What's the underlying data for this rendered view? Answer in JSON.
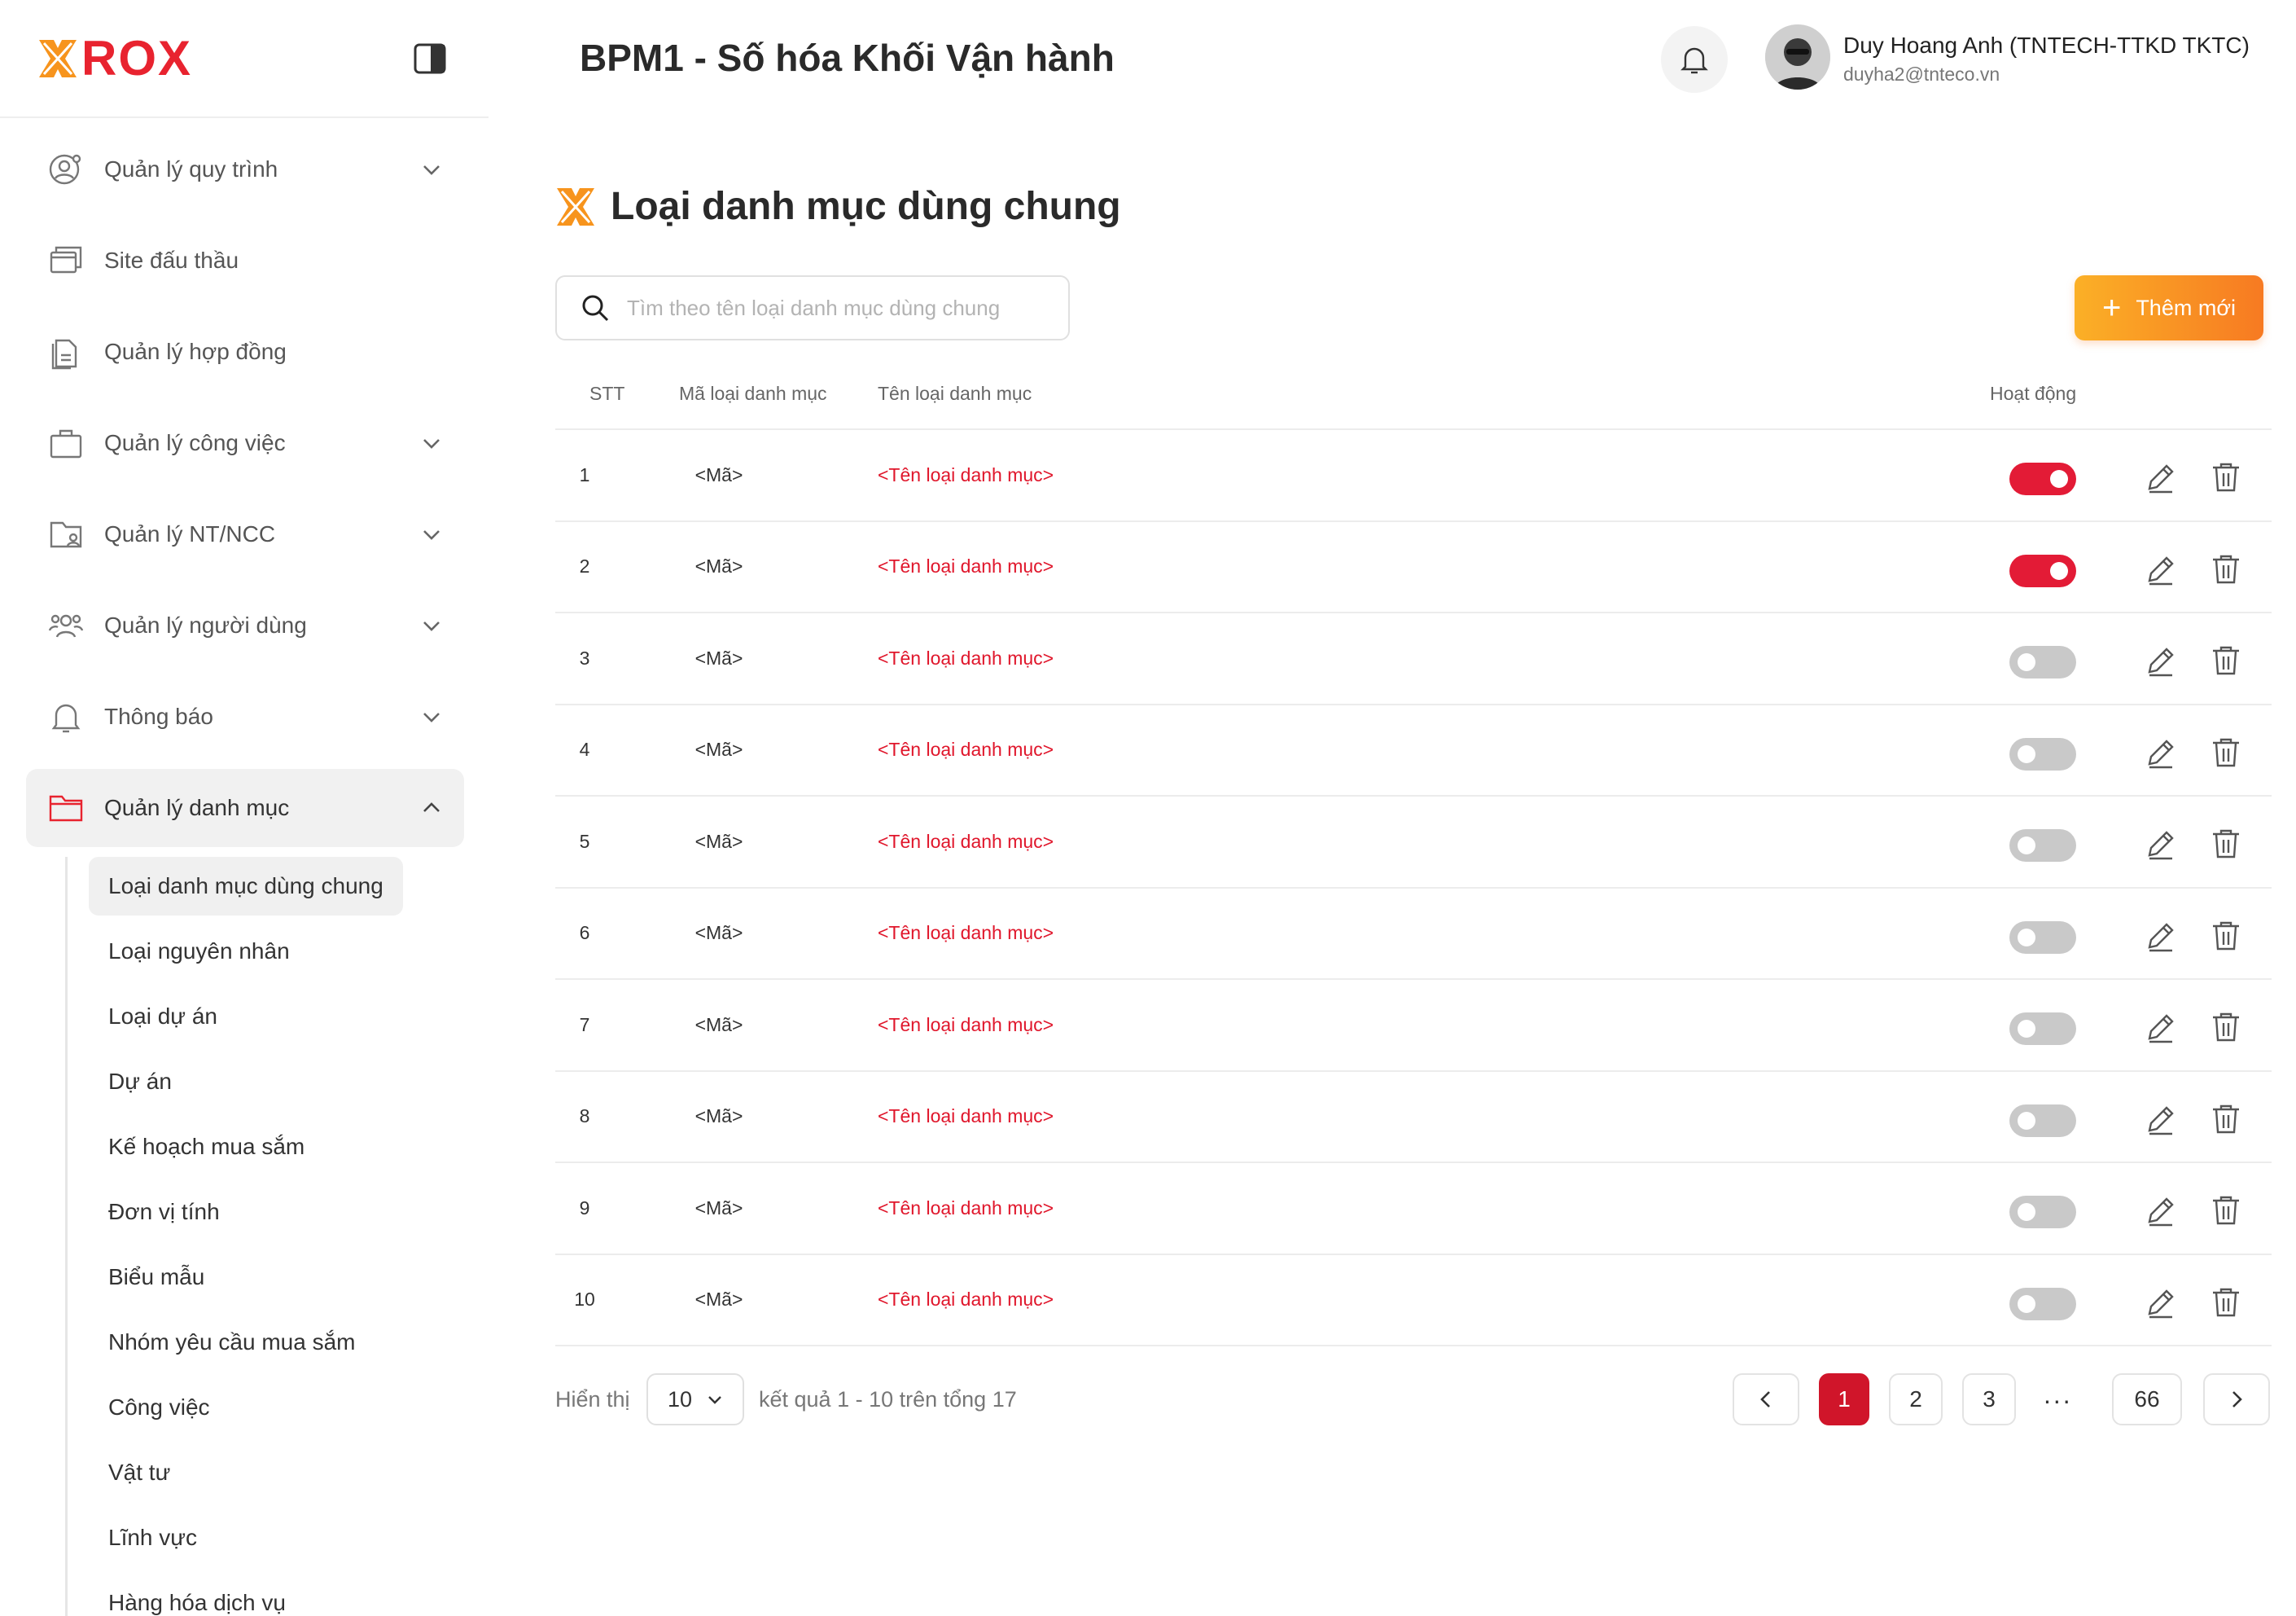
{
  "brand": {
    "logo_text": "ROX",
    "accent": "#e8232f",
    "orange": "#f7941d"
  },
  "header": {
    "app_title": "BPM1 - Số hóa Khối Vận hành",
    "user_name": "Duy Hoang Anh (TNTECH-TTKD TKTC)",
    "user_email": "duyha2@tnteco.vn"
  },
  "sidebar": {
    "items": [
      {
        "label": "Quản lý quy trình",
        "icon": "user-gear-icon",
        "has_chevron": true
      },
      {
        "label": "Site đấu thầu",
        "icon": "windows-icon",
        "has_chevron": false
      },
      {
        "label": "Quản lý hợp đồng",
        "icon": "document-icon",
        "has_chevron": false
      },
      {
        "label": "Quản lý công việc",
        "icon": "briefcase-icon",
        "has_chevron": true
      },
      {
        "label": "Quản lý NT/NCC",
        "icon": "folder-user-icon",
        "has_chevron": true
      },
      {
        "label": "Quản lý người dùng",
        "icon": "users-icon",
        "has_chevron": true
      },
      {
        "label": "Thông báo",
        "icon": "bell-icon",
        "has_chevron": true
      },
      {
        "label": "Quản lý danh mục",
        "icon": "folder-icon",
        "has_chevron": true,
        "expanded": true
      }
    ],
    "sub_items": [
      "Loại danh mục dùng chung",
      "Loại nguyên nhân",
      "Loại dự án",
      "Dự án",
      "Kế hoạch mua sắm",
      "Đơn vị tính",
      "Biểu mẫu",
      "Nhóm yêu cầu mua sắm",
      "Công việc",
      "Vật tư",
      "Lĩnh vực",
      "Hàng hóa dịch vụ"
    ],
    "active_sub": "Loại danh mục dùng chung"
  },
  "main": {
    "title": "Loại danh mục dùng chung",
    "search_placeholder": "Tìm theo tên loại danh mục dùng chung",
    "add_button": "Thêm mới",
    "columns": {
      "stt": "STT",
      "code": "Mã loại danh mục",
      "name": "Tên loại danh mục",
      "active": "Hoạt động"
    },
    "rows": [
      {
        "stt": "1",
        "code": "<Mã>",
        "name": "<Tên loại danh mục>",
        "active": true
      },
      {
        "stt": "2",
        "code": "<Mã>",
        "name": "<Tên loại danh mục>",
        "active": true
      },
      {
        "stt": "3",
        "code": "<Mã>",
        "name": "<Tên loại danh mục>",
        "active": false
      },
      {
        "stt": "4",
        "code": "<Mã>",
        "name": "<Tên loại danh mục>",
        "active": false
      },
      {
        "stt": "5",
        "code": "<Mã>",
        "name": "<Tên loại danh mục>",
        "active": false
      },
      {
        "stt": "6",
        "code": "<Mã>",
        "name": "<Tên loại danh mục>",
        "active": false
      },
      {
        "stt": "7",
        "code": "<Mã>",
        "name": "<Tên loại danh mục>",
        "active": false
      },
      {
        "stt": "8",
        "code": "<Mã>",
        "name": "<Tên loại danh mục>",
        "active": false
      },
      {
        "stt": "9",
        "code": "<Mã>",
        "name": "<Tên loại danh mục>",
        "active": false
      },
      {
        "stt": "10",
        "code": "<Mã>",
        "name": "<Tên loại danh mục>",
        "active": false
      }
    ]
  },
  "pagination": {
    "show_label": "Hiển thị",
    "page_size": "10",
    "result_text": "kết quả 1 - 10 trên tổng 17",
    "pages": [
      "1",
      "2",
      "3"
    ],
    "ellipsis": "...",
    "last_page": "66",
    "current_page": "1"
  },
  "colors": {
    "toggle_on": "#e31b36",
    "toggle_off": "#c9c9c9",
    "link_red": "#e0162b",
    "page_active": "#d0152a"
  }
}
